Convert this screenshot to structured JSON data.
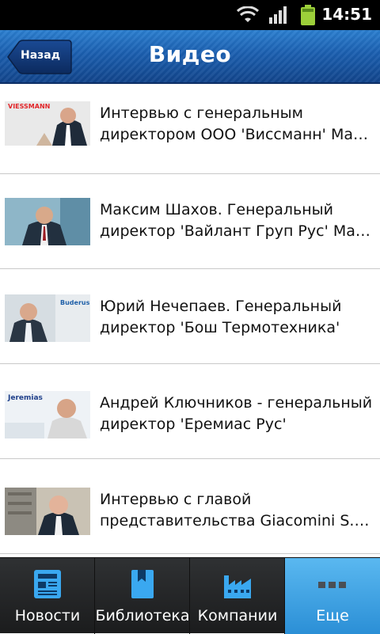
{
  "status_bar": {
    "time": "14:51"
  },
  "header": {
    "back_label": "Назад",
    "title": "Видео"
  },
  "videos": [
    {
      "line1": "Интервью с генеральным",
      "line2": "директором ООО 'Виссманн' Мар...",
      "thumb": "viessmann"
    },
    {
      "line1": "Максим Шахов. Генеральный",
      "line2": "директор 'Вайлант Груп Рус' Макс...",
      "thumb": "vaillant"
    },
    {
      "line1": "Юрий Нечепаев. Генеральный",
      "line2": "директор 'Бош Термотехника'",
      "thumb": "buderus"
    },
    {
      "line1": "Андрей Ключников - генеральный",
      "line2": "директор 'Еремиас Рус'",
      "thumb": "jeremias"
    },
    {
      "line1": "Интервью с главой",
      "line2": "представительства Giacomini S.p....",
      "thumb": "giacomini"
    }
  ],
  "thumb_logos": {
    "viessmann": "VIESSMANN",
    "buderus": "Buderus",
    "jeremias": "Jeremias"
  },
  "tabs": [
    {
      "label": "Новости",
      "icon": "news-icon",
      "active": false
    },
    {
      "label": "Библиотека",
      "icon": "library-icon",
      "active": false
    },
    {
      "label": "Компании",
      "icon": "factory-icon",
      "active": false
    },
    {
      "label": "Еще",
      "icon": "more-icon",
      "active": true
    }
  ],
  "colors": {
    "header": "#1b5fb0",
    "active_tab": "#3aa0e0",
    "tab_icon": "#3aa8f0"
  }
}
